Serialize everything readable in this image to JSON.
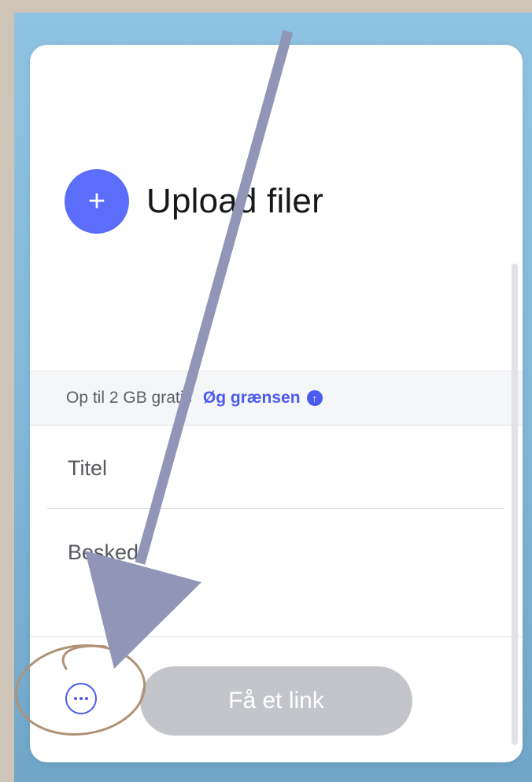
{
  "upload": {
    "icon": "plus-icon",
    "label": "Upload filer"
  },
  "limit": {
    "text": "Op til 2 GB gratis",
    "link_label": "Øg grænsen",
    "link_icon": "arrow-up-circle-icon"
  },
  "form": {
    "title_placeholder": "Titel",
    "message_placeholder": "Besked"
  },
  "footer": {
    "more_icon": "more-options-icon",
    "submit_label": "Få et link"
  },
  "colors": {
    "accent": "#5b6dfa",
    "link": "#4b5bf0",
    "disabled_button": "#c3c5ca",
    "annotation_arrow": "#9195b7",
    "annotation_circle": "#b09277",
    "background": "#8fc3e2"
  }
}
